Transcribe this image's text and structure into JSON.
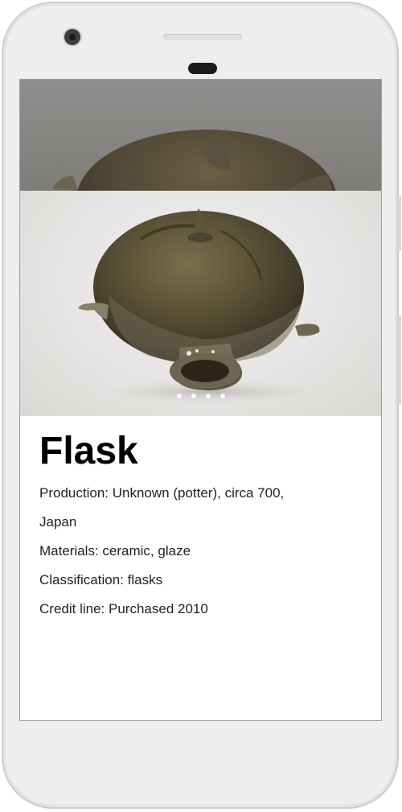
{
  "device": {
    "frame_color": "#eeeef0",
    "icons": [
      "front-camera-icon",
      "earpiece-speaker-icon",
      "proximity-sensor-icon"
    ]
  },
  "gallery": {
    "image_count": 4,
    "active_index": 0,
    "dot_color": "#ffffff",
    "images": [
      {
        "alt": "Flask"
      },
      {
        "alt": "Flask"
      }
    ]
  },
  "object": {
    "title": "Flask",
    "production_label": "Production:",
    "production_value": "Unknown (potter), circa 700,",
    "production_place": "Japan",
    "materials_label": "Materials:",
    "materials_value": "ceramic, glaze",
    "classification_label": "Classification:",
    "classification_value": "flasks",
    "credit_label": "Credit line:",
    "credit_value": "Purchased 2010"
  }
}
